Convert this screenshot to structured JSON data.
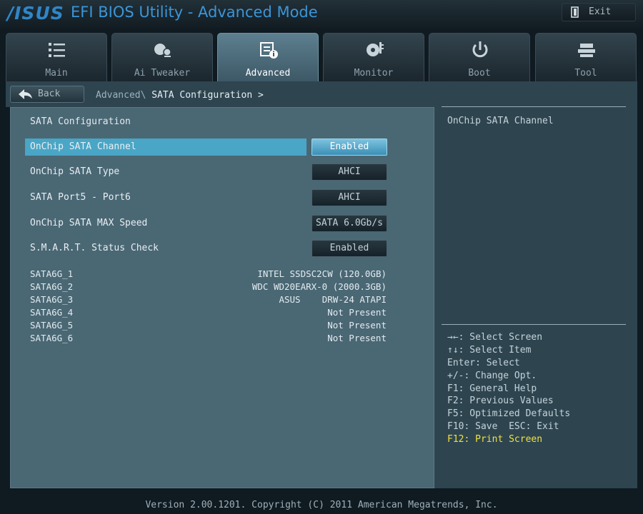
{
  "header": {
    "brand": "/ISUS",
    "title": "EFI BIOS Utility - Advanced Mode",
    "exit_label": "Exit"
  },
  "tabs": [
    {
      "label": "Main",
      "icon": "list-icon",
      "active": false
    },
    {
      "label": "Ai Tweaker",
      "icon": "tweaker-icon",
      "active": false
    },
    {
      "label": "Advanced",
      "icon": "advanced-icon",
      "active": true
    },
    {
      "label": "Monitor",
      "icon": "monitor-icon",
      "active": false
    },
    {
      "label": "Boot",
      "icon": "power-icon",
      "active": false
    },
    {
      "label": "Tool",
      "icon": "tool-icon",
      "active": false
    }
  ],
  "nav": {
    "back_label": "Back",
    "breadcrumb_parent": "Advanced\\",
    "breadcrumb_current": "SATA Configuration",
    "breadcrumb_arrow": ">"
  },
  "main": {
    "section_title": "SATA Configuration",
    "items": [
      {
        "label": "OnChip SATA Channel",
        "value": "Enabled",
        "selected": true
      },
      {
        "label": "OnChip SATA Type",
        "value": "AHCI",
        "selected": false
      },
      {
        "label": " SATA Port5 - Port6",
        "value": "AHCI",
        "selected": false
      },
      {
        "label": "OnChip SATA MAX Speed",
        "value": "SATA 6.0Gb/s",
        "selected": false
      },
      {
        "label": "S.M.A.R.T. Status Check",
        "value": "Enabled",
        "selected": false
      }
    ],
    "devices": [
      {
        "port": "SATA6G_1",
        "device": "INTEL SSDSC2CW (120.0GB)"
      },
      {
        "port": "SATA6G_2",
        "device": "WDC WD20EARX-0 (2000.3GB)"
      },
      {
        "port": "SATA6G_3",
        "device": "ASUS    DRW-24 ATAPI"
      },
      {
        "port": "SATA6G_4",
        "device": "Not Present"
      },
      {
        "port": "SATA6G_5",
        "device": "Not Present"
      },
      {
        "port": "SATA6G_6",
        "device": "Not Present"
      }
    ]
  },
  "help": {
    "description": "OnChip SATA Channel",
    "keys": [
      {
        "text": "→←: Select Screen",
        "highlight": false
      },
      {
        "text": "↑↓: Select Item",
        "highlight": false
      },
      {
        "text": "Enter: Select",
        "highlight": false
      },
      {
        "text": "+/-: Change Opt.",
        "highlight": false
      },
      {
        "text": "F1: General Help",
        "highlight": false
      },
      {
        "text": "F2: Previous Values",
        "highlight": false
      },
      {
        "text": "F5: Optimized Defaults",
        "highlight": false
      },
      {
        "text": "F10: Save  ESC: Exit",
        "highlight": false
      },
      {
        "text": "F12: Print Screen",
        "highlight": true
      }
    ]
  },
  "footer": {
    "version": "Version 2.00.1201. Copyright (C) 2011 American Megatrends, Inc."
  },
  "colors": {
    "accent": "#4aa6c6",
    "highlight_key": "#f0e040",
    "brand": "#2f86c8"
  }
}
